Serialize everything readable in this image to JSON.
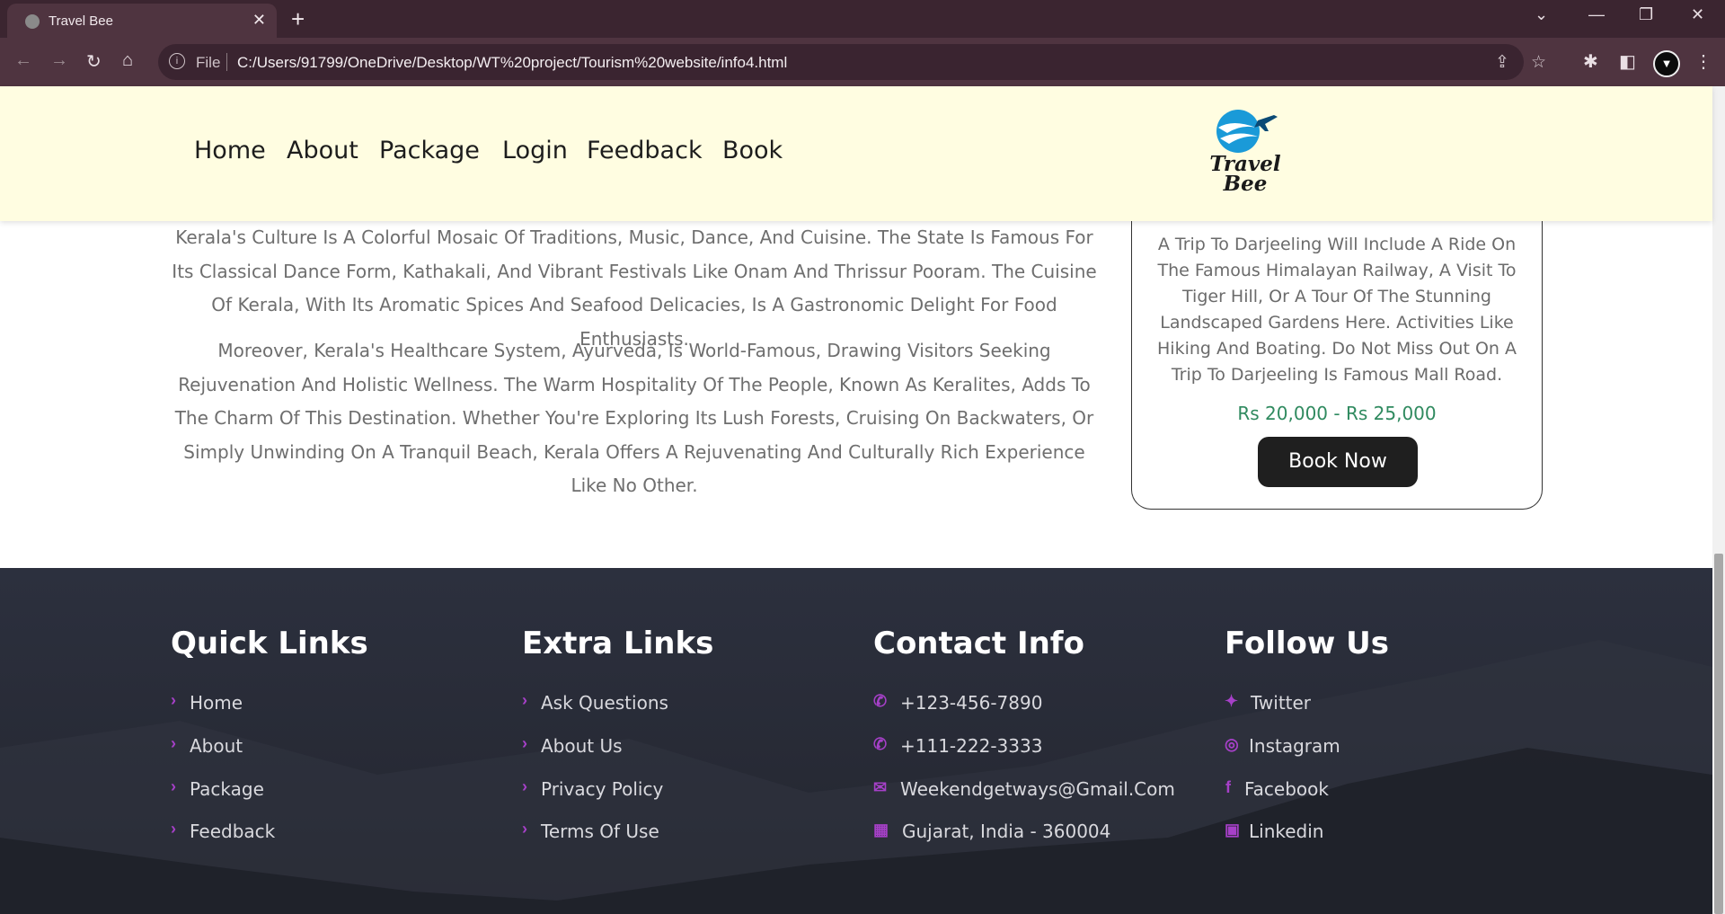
{
  "browser": {
    "tab_title": "Travel Bee",
    "file_label": "File",
    "url": "C:/Users/91799/OneDrive/Desktop/WT%20project/Tourism%20website/info4.html"
  },
  "nav": {
    "links": [
      "Home",
      "About",
      "Package",
      "Login",
      "Feedback",
      "Book"
    ]
  },
  "logo": {
    "line1": "Travel",
    "line2": "Bee"
  },
  "content": {
    "paragraph1": "Kerala's Culture Is A Colorful Mosaic Of Traditions, Music, Dance, And Cuisine. The State Is Famous For Its Classical Dance Form, Kathakali, And Vibrant Festivals Like Onam And Thrissur Pooram. The Cuisine Of Kerala, With Its Aromatic Spices And Seafood Delicacies, Is A Gastronomic Delight For Food Enthusiasts.",
    "paragraph2": "Moreover, Kerala's Healthcare System, Ayurveda, Is World-Famous, Drawing Visitors Seeking Rejuvenation And Holistic Wellness. The Warm Hospitality Of The People, Known As Keralites, Adds To The Charm Of This Destination. Whether You're Exploring Its Lush Forests, Cruising On Backwaters, Or Simply Unwinding On A Tranquil Beach, Kerala Offers A Rejuvenating And Culturally Rich Experience Like No Other."
  },
  "card": {
    "description": "A Trip To Darjeeling Will Include A Ride On The Famous Himalayan Railway, A Visit To Tiger Hill, Or A Tour Of The Stunning Landscaped Gardens Here. Activities Like Hiking And Boating. Do Not Miss Out On A Trip To Darjeeling Is Famous Mall Road.",
    "price": "Rs 20,000 - Rs 25,000",
    "button": "Book Now"
  },
  "footer": {
    "quick_links": {
      "title": "Quick Links",
      "items": [
        "Home",
        "About",
        "Package",
        "Feedback"
      ]
    },
    "extra_links": {
      "title": "Extra Links",
      "items": [
        "Ask Questions",
        "About Us",
        "Privacy Policy",
        "Terms Of Use"
      ]
    },
    "contact": {
      "title": "Contact Info",
      "items": [
        "+123-456-7890",
        "+111-222-3333",
        "Weekendgetways@Gmail.Com",
        "Gujarat, India - 360004"
      ]
    },
    "follow": {
      "title": "Follow Us",
      "items": [
        "Twitter",
        "Instagram",
        "Facebook",
        "Linkedin"
      ]
    }
  },
  "colors": {
    "accent": "#a640c8",
    "price": "#2f8a5f",
    "header_bg": "#fffde1",
    "footer_bg": "#2c303e"
  },
  "icons": [
    "globe-icon",
    "close-icon",
    "plus-icon",
    "chevron-down-icon",
    "minimize-icon",
    "restore-icon",
    "window-close-icon",
    "back-icon",
    "forward-icon",
    "reload-icon",
    "home-icon",
    "info-icon",
    "share-icon",
    "star-icon",
    "puzzle-icon",
    "sidebar-icon",
    "profile-icon",
    "kebab-icon",
    "chevron-right-icon",
    "phone-icon",
    "mail-icon",
    "map-icon",
    "twitter-icon",
    "instagram-icon",
    "facebook-icon",
    "linkedin-icon"
  ]
}
